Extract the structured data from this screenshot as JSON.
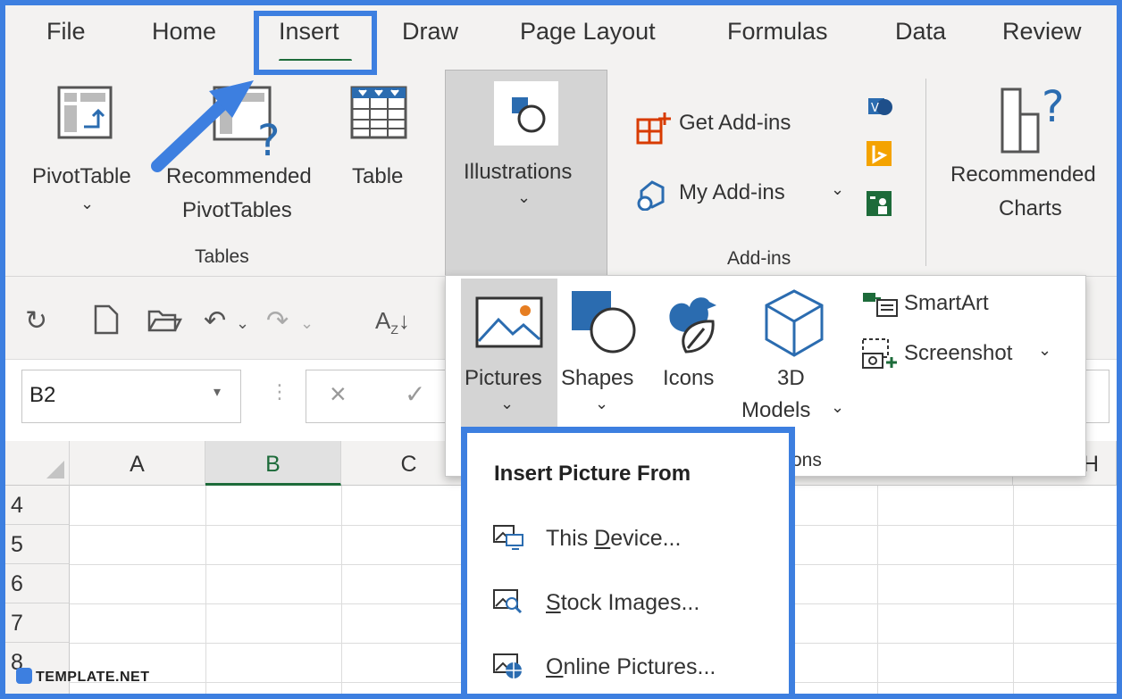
{
  "tabs": [
    "File",
    "Home",
    "Insert",
    "Draw",
    "Page Layout",
    "Formulas",
    "Data",
    "Review"
  ],
  "ribbon": {
    "pivot_table": "PivotTable",
    "recommended_pivot_line1": "Recommended",
    "recommended_pivot_line2": "PivotTables",
    "table": "Table",
    "group_tables": "Tables",
    "illustrations": "Illustrations",
    "get_addins": "Get Add-ins",
    "my_addins": "My Add-ins",
    "group_addins": "Add-ins",
    "recommended_charts_line1": "Recommended",
    "recommended_charts_line2": "Charts"
  },
  "formula_bar": {
    "name_box": "B2"
  },
  "grid": {
    "columns": [
      "A",
      "B",
      "C",
      "H"
    ],
    "rows": [
      "4",
      "5",
      "6",
      "7",
      "8"
    ]
  },
  "illustrations_panel": {
    "pictures": "Pictures",
    "shapes": "Shapes",
    "icons": "Icons",
    "models_line1": "3D",
    "models_line2": "Models",
    "smartart": "SmartArt",
    "screenshot": "Screenshot",
    "group_label": "ons"
  },
  "insert_picture_menu": {
    "heading": "Insert Picture From",
    "items": [
      {
        "prefix": "This ",
        "accel": "D",
        "suffix": "evice..."
      },
      {
        "prefix": "",
        "accel": "S",
        "suffix": "tock Images..."
      },
      {
        "prefix": "",
        "accel": "O",
        "suffix": "nline Pictures..."
      }
    ]
  },
  "watermark": "TEMPLATE.NET",
  "colors": {
    "highlight": "#3d7fe0",
    "excel_green": "#1d6b3a",
    "addin_red": "#d83b01"
  }
}
